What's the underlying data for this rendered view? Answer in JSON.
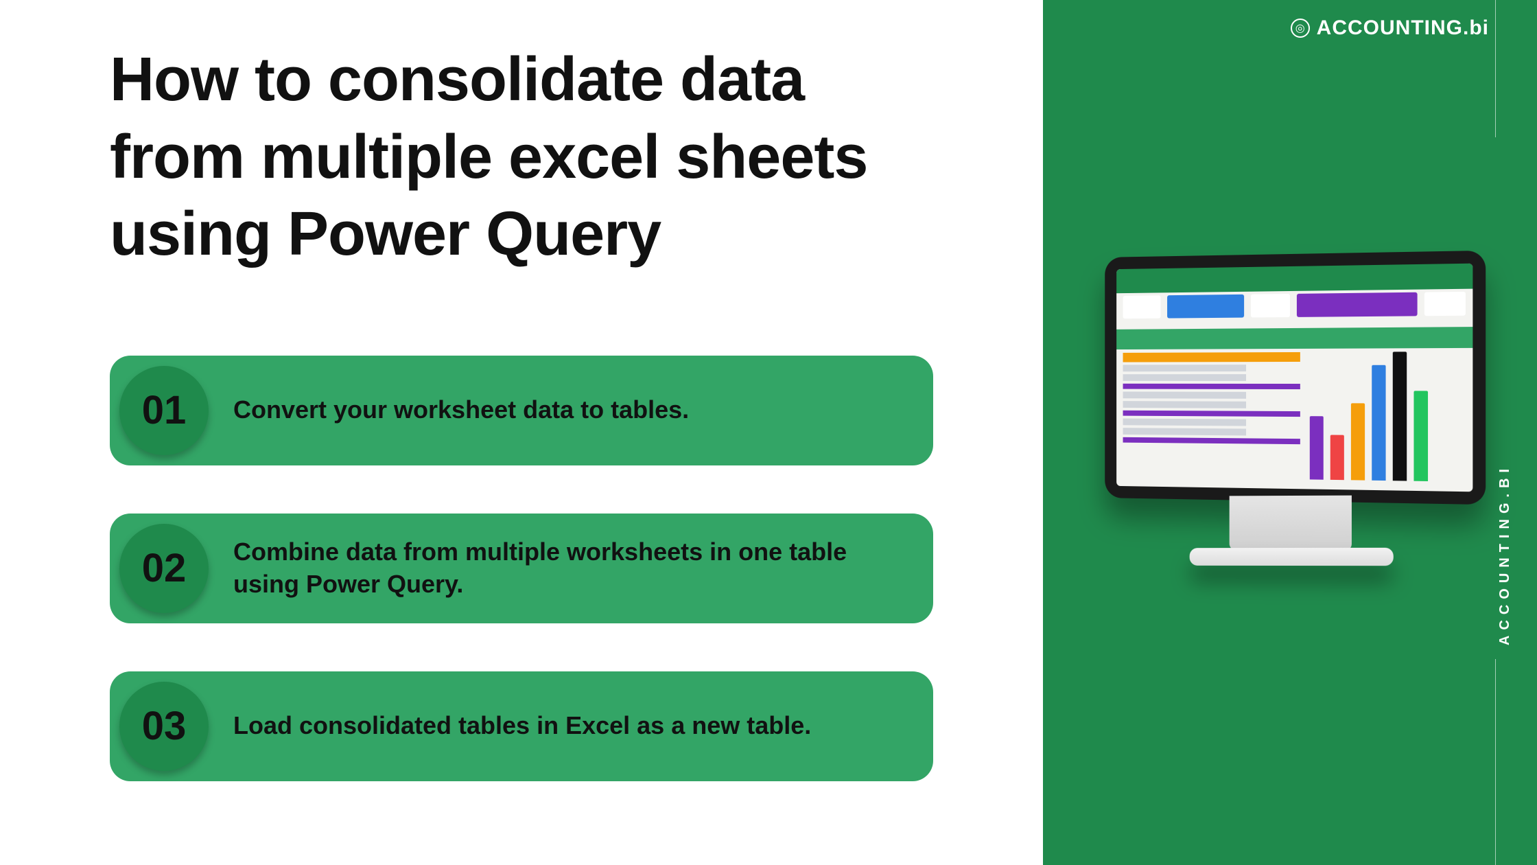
{
  "title": "How to consolidate data from multiple excel sheets using Power Query",
  "steps": [
    {
      "num": "01",
      "text": "Convert your worksheet data to tables."
    },
    {
      "num": "02",
      "text": "Combine data from multiple worksheets in one table using Power Query."
    },
    {
      "num": "03",
      "text": "Load consolidated tables in Excel as a new table."
    }
  ],
  "brand": {
    "logo_text": "ACCOUNTING.bi",
    "side_text": "ACCOUNTING.BI"
  },
  "colors": {
    "panel": "#1f8a4c",
    "step_bg": "#33a566",
    "step_circle": "#1f8a4c"
  }
}
